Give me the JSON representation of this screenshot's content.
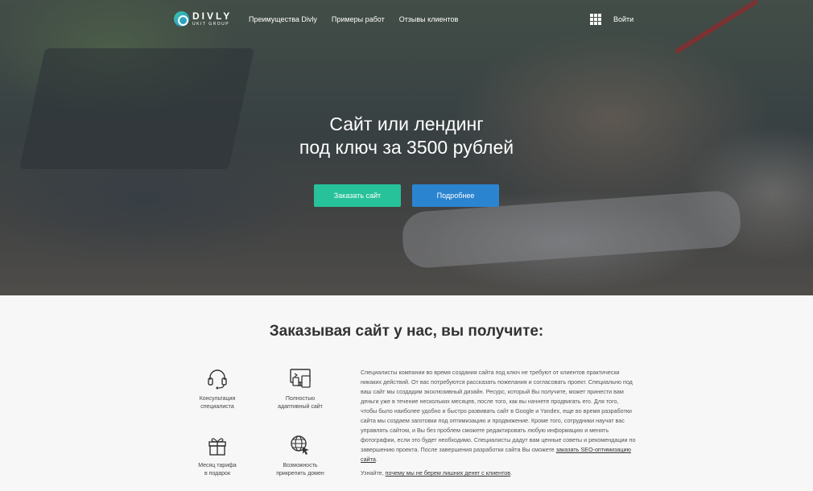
{
  "brand": {
    "name": "DIVLY",
    "sub": "UKIT GROUP"
  },
  "nav": {
    "links": [
      "Преимущества Divly",
      "Примеры работ",
      "Отзывы клиентов"
    ],
    "login": "Войти"
  },
  "hero": {
    "title_line1": "Сайт или лендинг",
    "title_line2": "под ключ за 3500 рублей",
    "btn_order": "Заказать сайт",
    "btn_more": "Подробнее"
  },
  "section": {
    "title": "Заказывая сайт у нас, вы получите:",
    "features": [
      {
        "icon": "headset-icon",
        "line1": "Консультация",
        "line2": "специалиста"
      },
      {
        "icon": "responsive-devices-icon",
        "line1": "Полностью",
        "line2": "адаптивный сайт"
      },
      {
        "icon": "gift-icon",
        "line1": "Месяц тарифа",
        "line2": "в подарок"
      },
      {
        "icon": "globe-cursor-icon",
        "line1": "Возможность",
        "line2": "прикрепить домен"
      }
    ],
    "description": "Специалисты компании во время создания сайта под ключ не требуют от клиентов практически никаких действий. От вас потребуются рассказать пожелания и согласовать проект. Специально под ваш сайт мы создадим эксклюзивный дизайн. Ресурс, который Вы получите, может принести вам деньги уже в течение нескольких месяцев, после того, как вы начнете продвигать его. Для того, чтобы было наиболее удобно и быстро развивать сайт в Google и Yandex, еще во время разработки сайта мы создаем заготовки под оптимизацию и продвижение. Кроме того, сотрудники научат вас управлять сайтом, и Вы без проблем сможете редактировать любую информацию и менять фотографии, если это будет необходимо. Специалисты дадут вам ценные советы и рекомендации по завершению проекта. После завершения разработки сайта Вы сможете",
    "seo_link": "заказать SEO-оптимизацию сайта",
    "learn_prefix": "Узнайте,",
    "learn_link": "почему мы не берем лишних денег с клиентов"
  }
}
